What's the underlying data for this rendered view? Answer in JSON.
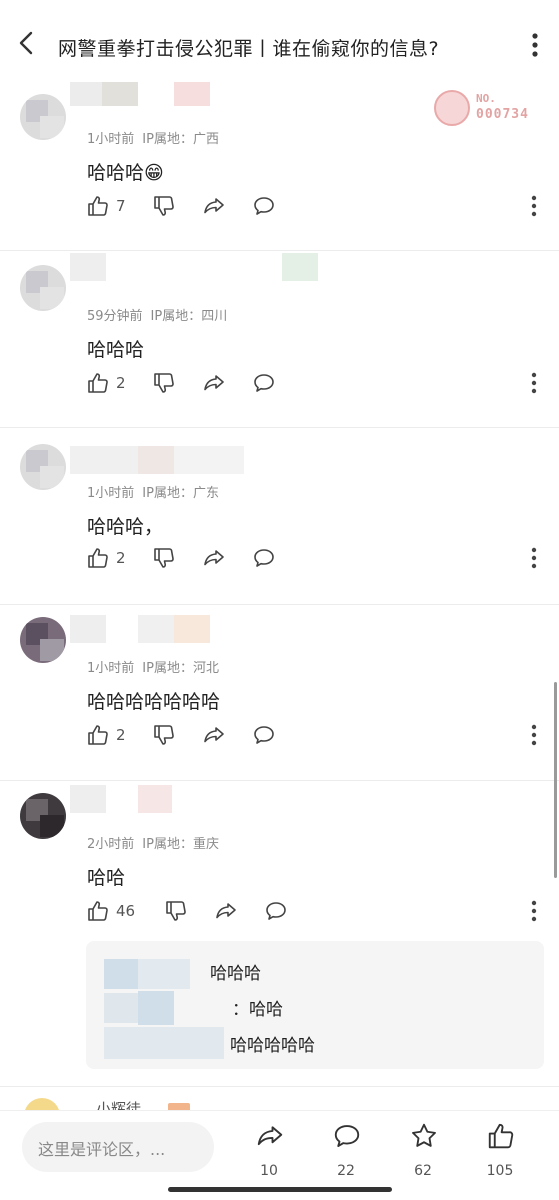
{
  "header": {
    "title": "网警重拳打击侵公犯罪丨谁在偷窥你的信息?",
    "back_icon": "chevron-left-icon",
    "more_icon": "more-vertical-icon"
  },
  "badge": {
    "label": "NO.",
    "number": "000734"
  },
  "comments": [
    {
      "time": "1小时前",
      "ip": "IP属地：广西",
      "text": "哈哈哈😁",
      "likes": "7"
    },
    {
      "time": "59分钟前",
      "ip": "IP属地：四川",
      "text": "哈哈哈",
      "likes": "2"
    },
    {
      "time": "1小时前",
      "ip": "IP属地：广东",
      "text": "哈哈哈，",
      "likes": "2"
    },
    {
      "time": "1小时前",
      "ip": "IP属地：河北",
      "text": "哈哈哈哈哈哈哈",
      "likes": "2"
    },
    {
      "time": "2小时前",
      "ip": "IP属地：重庆",
      "text": "哈哈",
      "likes": "46"
    }
  ],
  "replies": [
    {
      "text": "哈哈哈"
    },
    {
      "text": "：哈哈"
    },
    {
      "text": "哈哈哈哈哈"
    }
  ],
  "partial_next": {
    "name": "小辉徒"
  },
  "bottom_bar": {
    "input_placeholder": "这里是评论区，...",
    "share_count": "10",
    "comment_count": "22",
    "favorite_count": "62",
    "like_count": "105"
  },
  "colors": {
    "badge": "#e2a3a3",
    "text": "#222222",
    "meta": "#8a8a8a"
  }
}
